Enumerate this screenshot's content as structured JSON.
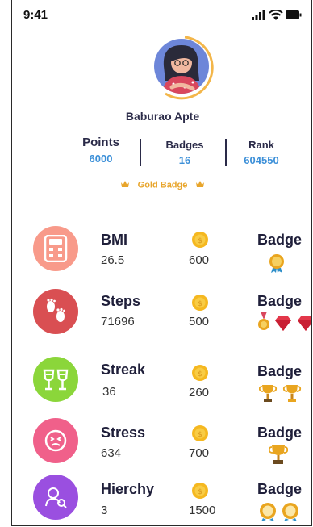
{
  "status_bar": {
    "time": "9:41"
  },
  "profile": {
    "name": "Baburao Apte"
  },
  "stats": [
    {
      "label": "Points",
      "value": "6000"
    },
    {
      "label": "Badges",
      "value": "16"
    },
    {
      "label": "Rank",
      "value": "604550"
    }
  ],
  "gold_badge_label": "Gold Badge",
  "colors": {
    "accent_blue": "#3b8fd8",
    "gold": "#e8a52b"
  },
  "rows": [
    {
      "title": "BMI",
      "value": "26.5",
      "points": "600",
      "badge_label": "Badge",
      "icon": "calculator-icon",
      "color": "#f89a8a"
    },
    {
      "title": "Steps",
      "value": "71696",
      "points": "500",
      "badge_label": "Badge",
      "icon": "footprints-icon",
      "color": "#d94f52"
    },
    {
      "title": "Streak",
      "value": "36",
      "points": "260",
      "badge_label": "Badge",
      "icon": "cheers-icon",
      "color": "#8bd63a"
    },
    {
      "title": "Stress",
      "value": "634",
      "points": "700",
      "badge_label": "Badge",
      "icon": "stressed-face-icon",
      "color": "#f0608a"
    },
    {
      "title": "Hierchy",
      "value": "3",
      "points": "1500",
      "badge_label": "Badge",
      "icon": "hierarchy-icon",
      "color": "#9a4fe0"
    }
  ]
}
